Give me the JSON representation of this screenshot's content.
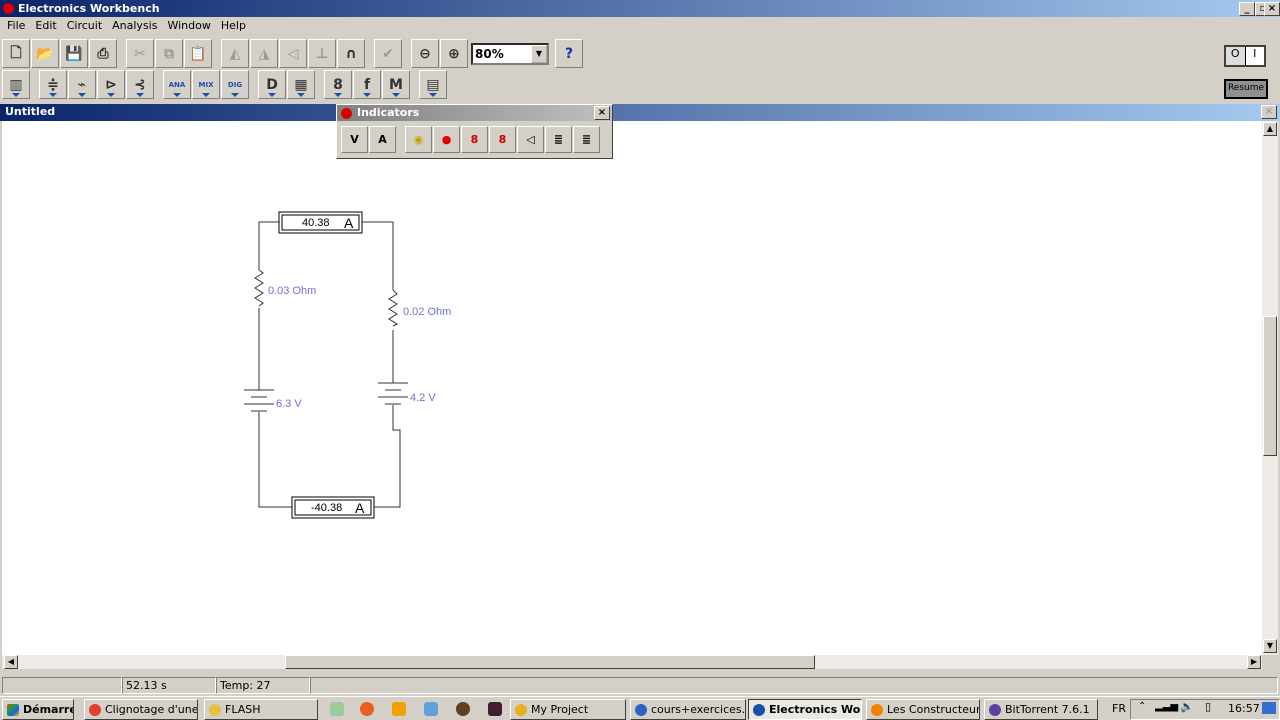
{
  "app": {
    "title": "Electronics Workbench"
  },
  "menu": [
    "File",
    "Edit",
    "Circuit",
    "Analysis",
    "Window",
    "Help"
  ],
  "toolbar1": [
    {
      "icon": "new-file-icon",
      "g": "🗋"
    },
    {
      "icon": "open-folder-icon",
      "g": "📂"
    },
    {
      "icon": "save-icon",
      "g": "💾"
    },
    {
      "icon": "print-icon",
      "g": "⎙"
    },
    {
      "gap": 1
    },
    {
      "icon": "cut-icon",
      "g": "✂",
      "dis": 1
    },
    {
      "icon": "copy-icon",
      "g": "⧉",
      "dis": 1
    },
    {
      "icon": "paste-icon",
      "g": "📋"
    },
    {
      "gap": 1
    },
    {
      "icon": "rotate-icon",
      "g": "◭",
      "dis": 1
    },
    {
      "icon": "flip-horizontal-icon",
      "g": "◮",
      "dis": 1
    },
    {
      "icon": "flip-vertical-icon",
      "g": "◁",
      "dis": 1
    },
    {
      "icon": "subcircuit-icon",
      "g": "⊥",
      "dis": 1
    },
    {
      "icon": "graph-icon",
      "g": "∩"
    },
    {
      "gap": 1
    },
    {
      "icon": "component-properties-icon",
      "g": "✔",
      "dis": 1
    },
    {
      "gap": 1
    },
    {
      "icon": "zoom-out-icon",
      "g": "⊖"
    },
    {
      "icon": "zoom-in-icon",
      "g": "⊕"
    }
  ],
  "zoom": {
    "value": "80%"
  },
  "help_glyph": "?",
  "toolbar2": [
    {
      "icon": "favorites-bin-icon",
      "g": "▥"
    },
    {
      "gap": 1
    },
    {
      "icon": "sources-bin-icon",
      "g": "≑"
    },
    {
      "icon": "basic-bin-icon",
      "g": "⌁"
    },
    {
      "icon": "diodes-bin-icon",
      "g": "⊳"
    },
    {
      "icon": "transistors-bin-icon",
      "g": "⊰"
    },
    {
      "gap": 1
    },
    {
      "icon": "analog-ics-bin-icon",
      "g": "ANA"
    },
    {
      "icon": "mixed-ics-bin-icon",
      "g": "MIX"
    },
    {
      "icon": "digital-ics-bin-icon",
      "g": "DIG"
    },
    {
      "gap": 1
    },
    {
      "icon": "logic-gates-bin-icon",
      "g": "D"
    },
    {
      "icon": "digital-bin-icon",
      "g": "▦"
    },
    {
      "gap": 1
    },
    {
      "icon": "indicators-bin-icon",
      "g": "8"
    },
    {
      "icon": "controls-bin-icon",
      "g": "f"
    },
    {
      "icon": "miscellaneous-bin-icon",
      "g": "M"
    },
    {
      "gap": 1
    },
    {
      "icon": "instruments-bin-icon",
      "g": "▤"
    }
  ],
  "power_switch": {
    "off": "O",
    "on": "I"
  },
  "pause_button": "Resume",
  "document": {
    "title": "Untitled"
  },
  "indicators": {
    "title": "Indicators",
    "items": [
      {
        "icon": "voltmeter-icon",
        "g": "V"
      },
      {
        "icon": "ammeter-icon",
        "g": "A"
      },
      {
        "icon": "bulb-icon",
        "g": "◉",
        "c": "#c8a000"
      },
      {
        "icon": "red-probe-icon",
        "g": "●",
        "c": "#e00000"
      },
      {
        "icon": "seven-segment-display-icon",
        "g": "8",
        "c": "#c00"
      },
      {
        "icon": "decoded-seven-segment-icon",
        "g": "8",
        "c": "#c00"
      },
      {
        "icon": "buzzer-icon",
        "g": "◁"
      },
      {
        "icon": "bargraph-icon",
        "g": "≣"
      },
      {
        "icon": "decoded-bargraph-icon",
        "g": "≣"
      }
    ]
  },
  "circuit": {
    "ammeter_top": {
      "value": "40.38",
      "unit": "A"
    },
    "ammeter_bottom": {
      "value": "-40.38",
      "unit": "A"
    },
    "resistor_left": "0.03  Ohm",
    "resistor_right": "0.02  Ohm",
    "battery_left": "6.3 V",
    "battery_right": "4.2 V"
  },
  "status": {
    "time": "52.13 s",
    "temp": "Temp:  27"
  },
  "taskbar": {
    "start": "Démarrer",
    "tasks": [
      {
        "label": "Clignotage d'une ...",
        "c": "#e04030"
      },
      {
        "label": "FLASH",
        "c": "#e8c040"
      },
      {
        "label": "My Project",
        "c": "#e8b020"
      },
      {
        "label": "cours+exercices....",
        "c": "#3060c0"
      },
      {
        "label": "Electronics Wor...",
        "c": "#1c4fa8",
        "active": true
      },
      {
        "label": "Les Constructeur...",
        "c": "#f08000"
      },
      {
        "label": "BitTorrent 7.6.1",
        "c": "#6040a0"
      }
    ],
    "lang": "FR",
    "clock": "16:57"
  }
}
